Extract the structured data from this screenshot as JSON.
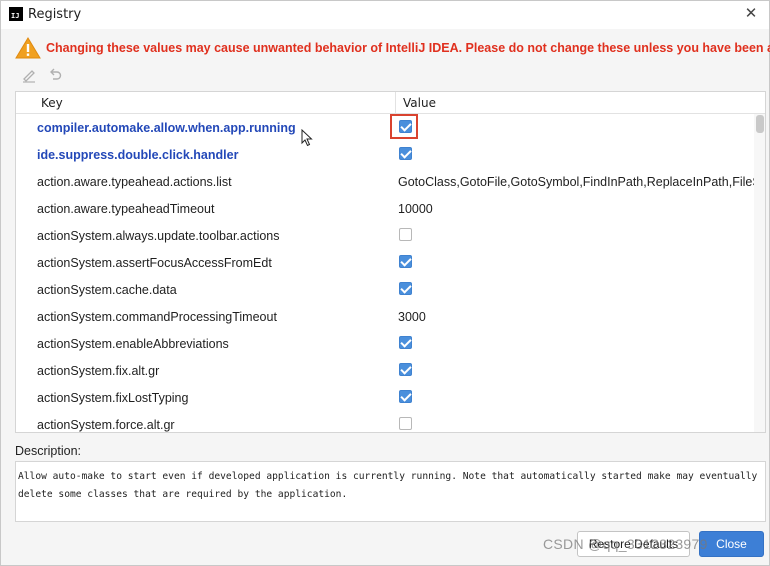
{
  "window": {
    "title": "Registry",
    "app_icon_text": "IJ",
    "close_glyph": "✕"
  },
  "warning": {
    "icon": "warning-triangle-icon",
    "text": "Changing these values may cause unwanted behavior of IntelliJ IDEA. Please do not change these unless you have been asked."
  },
  "toolbar": {
    "edit_icon": "pencil-icon",
    "revert_icon": "undo-icon"
  },
  "table": {
    "headers": {
      "key": "Key",
      "value": "Value"
    },
    "rows": [
      {
        "key": "compiler.automake.allow.when.app.running",
        "type": "checkbox",
        "checked": true,
        "modified": true,
        "value": ""
      },
      {
        "key": "ide.suppress.double.click.handler",
        "type": "checkbox",
        "checked": true,
        "modified": true,
        "value": ""
      },
      {
        "key": "action.aware.typeahead.actions.list",
        "type": "text",
        "value": "GotoClass,GotoFile,GotoSymbol,FindInPath,ReplaceInPath,FileStruc"
      },
      {
        "key": "action.aware.typeaheadTimeout",
        "type": "text",
        "value": "10000"
      },
      {
        "key": "actionSystem.always.update.toolbar.actions",
        "type": "checkbox",
        "checked": false,
        "value": ""
      },
      {
        "key": "actionSystem.assertFocusAccessFromEdt",
        "type": "checkbox",
        "checked": true,
        "value": ""
      },
      {
        "key": "actionSystem.cache.data",
        "type": "checkbox",
        "checked": true,
        "value": ""
      },
      {
        "key": "actionSystem.commandProcessingTimeout",
        "type": "text",
        "value": "3000"
      },
      {
        "key": "actionSystem.enableAbbreviations",
        "type": "checkbox",
        "checked": true,
        "value": ""
      },
      {
        "key": "actionSystem.fix.alt.gr",
        "type": "checkbox",
        "checked": true,
        "value": ""
      },
      {
        "key": "actionSystem.fixLostTyping",
        "type": "checkbox",
        "checked": true,
        "value": ""
      },
      {
        "key": "actionSystem.force.alt.gr",
        "type": "checkbox",
        "checked": false,
        "value": ""
      }
    ]
  },
  "description": {
    "label": "Description:",
    "text": "Allow auto-make to start even if developed application is currently running. Note that automatically started make may eventually delete some classes that are required by the application."
  },
  "buttons": {
    "restore": "Restore Defaults",
    "close": "Close"
  },
  "watermark": "CSDN @qq_3312323979",
  "colors": {
    "warning": "#e0301e",
    "modified_key": "#2348b8",
    "checkbox": "#4a8fdc",
    "highlight": "#d9432f",
    "primary_button": "#3d7fd6"
  }
}
